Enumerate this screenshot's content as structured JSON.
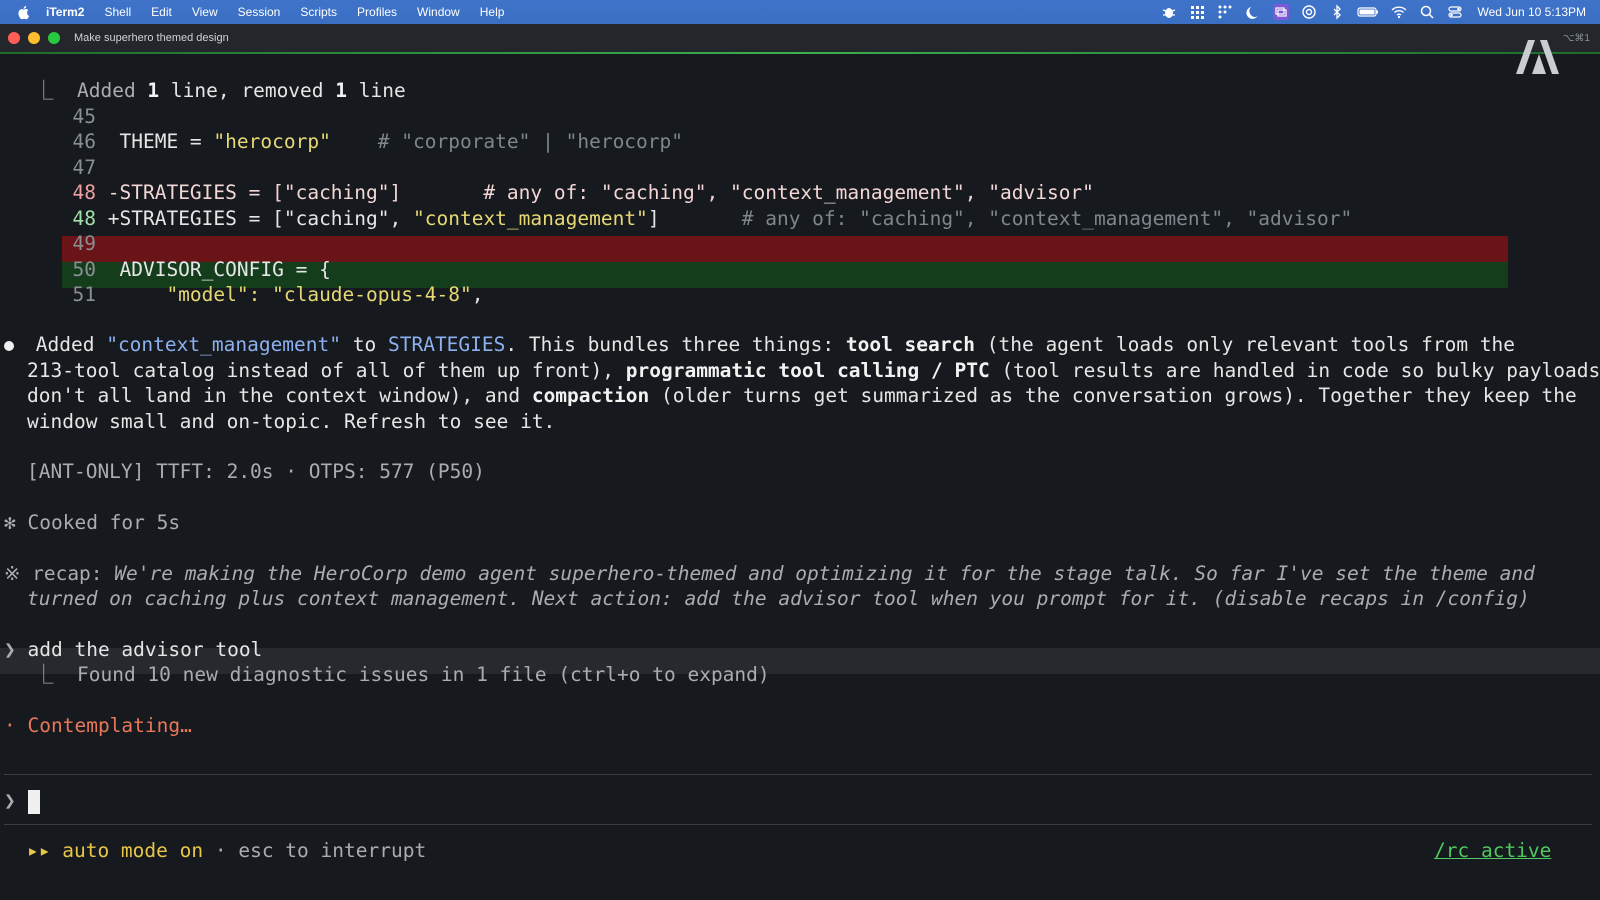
{
  "menubar": {
    "app_name": "iTerm2",
    "menus": [
      "Shell",
      "Edit",
      "View",
      "Session",
      "Scripts",
      "Profiles",
      "Window",
      "Help"
    ],
    "clock": "Wed Jun 10  5:13PM"
  },
  "window": {
    "title": "Make superhero themed design",
    "shortcut": "⌥⌘1"
  },
  "diff": {
    "summary_prefix": "⎿  Added ",
    "added_count": "1",
    "summary_middle": " line, removed ",
    "removed_count": "1",
    "summary_suffix": " line",
    "l45": "45",
    "l46": "46",
    "l46_code_a": "THEME = ",
    "l46_str": "\"herocorp\"",
    "l46_comment": "    # \"corporate\" | \"herocorp\"",
    "l47": "47",
    "l48": "48",
    "l48_del": "-STRATEGIES = [\"caching\"]       # any of: \"caching\", \"context_management\", \"advisor\"",
    "l48_add_a": "+STRATEGIES = [\"caching\", ",
    "l48_add_str": "\"context_management\"",
    "l48_add_b": "]",
    "l48_add_comment": "       # any of: \"caching\", \"context_management\", \"advisor\"",
    "l49": "49",
    "l50": "50",
    "l50_code": "ADVISOR_CONFIG = {",
    "l51": "51",
    "l51_key": "    \"model\": ",
    "l51_val": "\"claude-opus-4-8\"",
    "l51_end": ","
  },
  "message": {
    "p1_a": "Added ",
    "p1_str": "\"context_management\"",
    "p1_b": " to ",
    "p1_var": "STRATEGIES",
    "p1_c": ". This bundles three things: ",
    "p1_bold1": "tool search",
    "p1_d": " (the agent loads only relevant tools from the",
    "p2_a": "213-tool catalog instead of all of them up front), ",
    "p2_bold": "programmatic tool calling / PTC",
    "p2_b": " (tool results are handled in code so bulky payloads",
    "p3_a": "don't all land in the context window), and ",
    "p3_bold": "compaction",
    "p3_b": " (older turns get summarized as the conversation grows). Together they keep the",
    "p4": "window small and on-topic. Refresh to see it."
  },
  "stats": "[ANT-ONLY] TTFT: 2.0s · OTPS: 577 (P50)",
  "cooked": "Cooked for 5s",
  "recap": {
    "label": "recap: ",
    "line1": "We're making the HeroCorp demo agent superhero-themed and optimizing it for the stage talk. So far I've set the theme and",
    "line2": "turned on caching plus context management. Next action: add the advisor tool when you prompt for it. (disable recaps in /config)"
  },
  "user_prompt": "add the advisor tool",
  "diagnostics": "⎿  Found 10 new diagnostic issues in 1 file (ctrl+o to expand)",
  "status": "Contemplating…",
  "prompt_symbol": "❯",
  "footer": {
    "arrows": "▸▸",
    "mode": "auto mode on",
    "hint": " · esc to interrupt",
    "rc": "/rc active"
  }
}
